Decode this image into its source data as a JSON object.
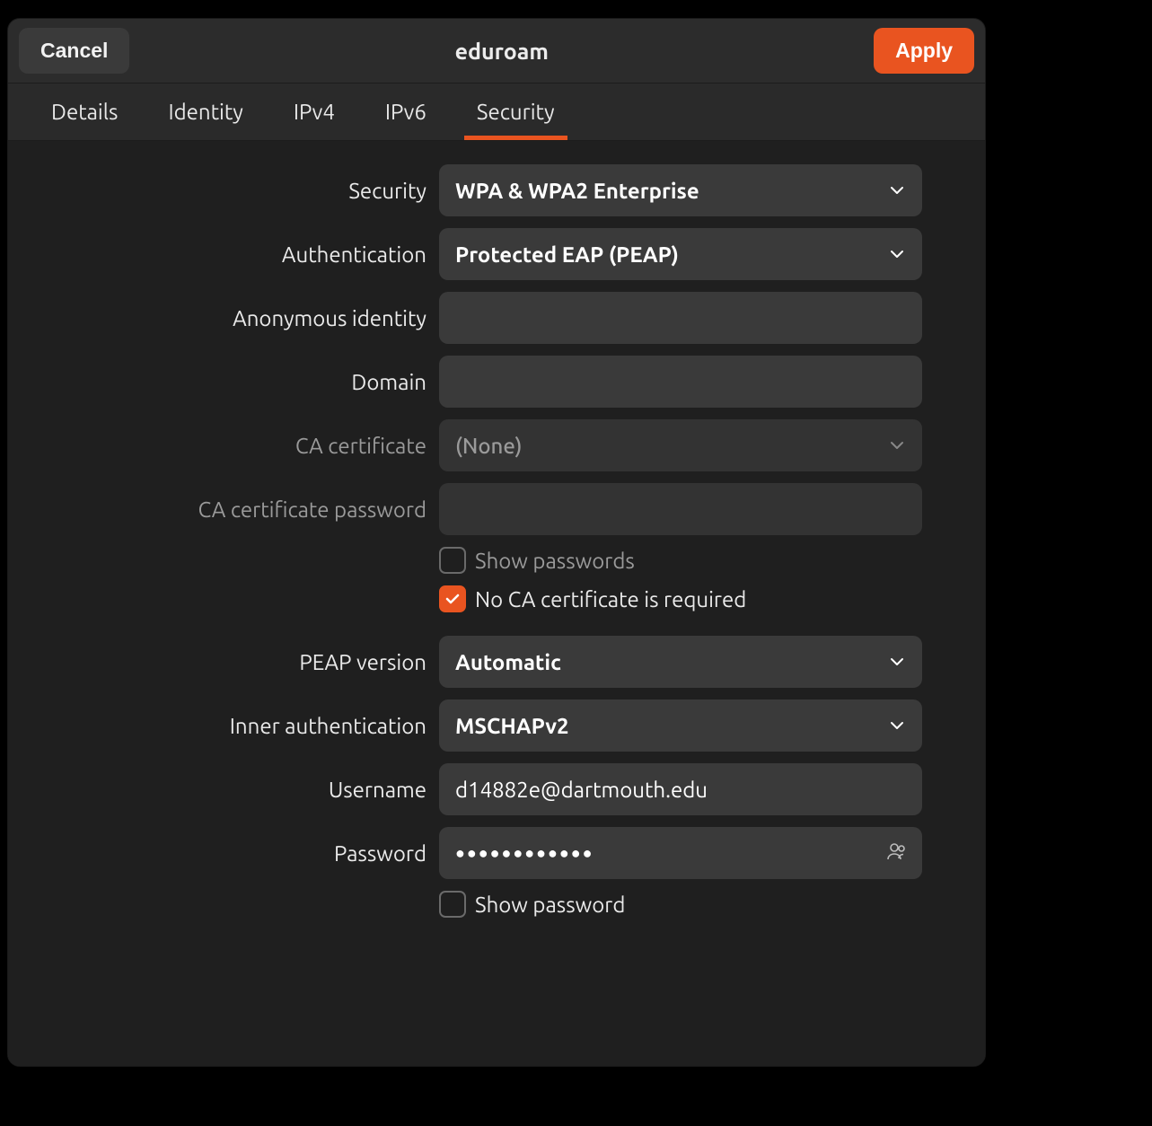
{
  "header": {
    "cancel": "Cancel",
    "title": "eduroam",
    "apply": "Apply"
  },
  "tabs": [
    "Details",
    "Identity",
    "IPv4",
    "IPv6",
    "Security"
  ],
  "active_tab": "Security",
  "form": {
    "security_label": "Security",
    "security_value": "WPA & WPA2 Enterprise",
    "auth_label": "Authentication",
    "auth_value": "Protected EAP (PEAP)",
    "anon_label": "Anonymous identity",
    "anon_value": "",
    "domain_label": "Domain",
    "domain_value": "",
    "ca_cert_label": "CA certificate",
    "ca_cert_value": "(None)",
    "ca_pw_label": "CA certificate password",
    "ca_pw_value": "",
    "show_pw1_label": "Show passwords",
    "show_pw1_checked": false,
    "no_ca_label": "No CA certificate is required",
    "no_ca_checked": true,
    "peap_label": "PEAP version",
    "peap_value": "Automatic",
    "inner_auth_label": "Inner authentication",
    "inner_auth_value": "MSCHAPv2",
    "username_label": "Username",
    "username_value": "d14882e@dartmouth.edu",
    "password_label": "Password",
    "password_value": "●●●●●●●●●●●●",
    "show_pw2_label": "Show password",
    "show_pw2_checked": false
  },
  "colors": {
    "accent": "#e95420",
    "bg_dialog": "#2a2a2a",
    "bg_form": "#1f1f1f",
    "bg_input": "#3a3a3a"
  }
}
